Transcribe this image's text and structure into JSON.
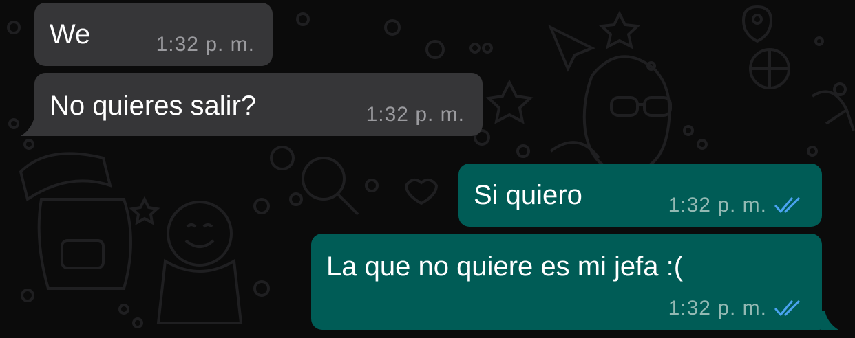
{
  "chat": {
    "messages": [
      {
        "direction": "incoming",
        "text": "We",
        "time": "1:32 p. m."
      },
      {
        "direction": "incoming",
        "text": "No quieres salir?",
        "time": "1:32 p. m."
      },
      {
        "direction": "outgoing",
        "text": "Si quiero",
        "time": "1:32 p. m.",
        "status_icon": "double-check-icon"
      },
      {
        "direction": "outgoing",
        "text": "La que no quiere es mi jefa :(",
        "time": "1:32 p. m.",
        "status_icon": "double-check-icon"
      }
    ]
  },
  "colors": {
    "background": "#0b0b0b",
    "incoming_bubble": "#363638",
    "outgoing_bubble": "#005c56",
    "read_tick": "#4aa3f0"
  }
}
